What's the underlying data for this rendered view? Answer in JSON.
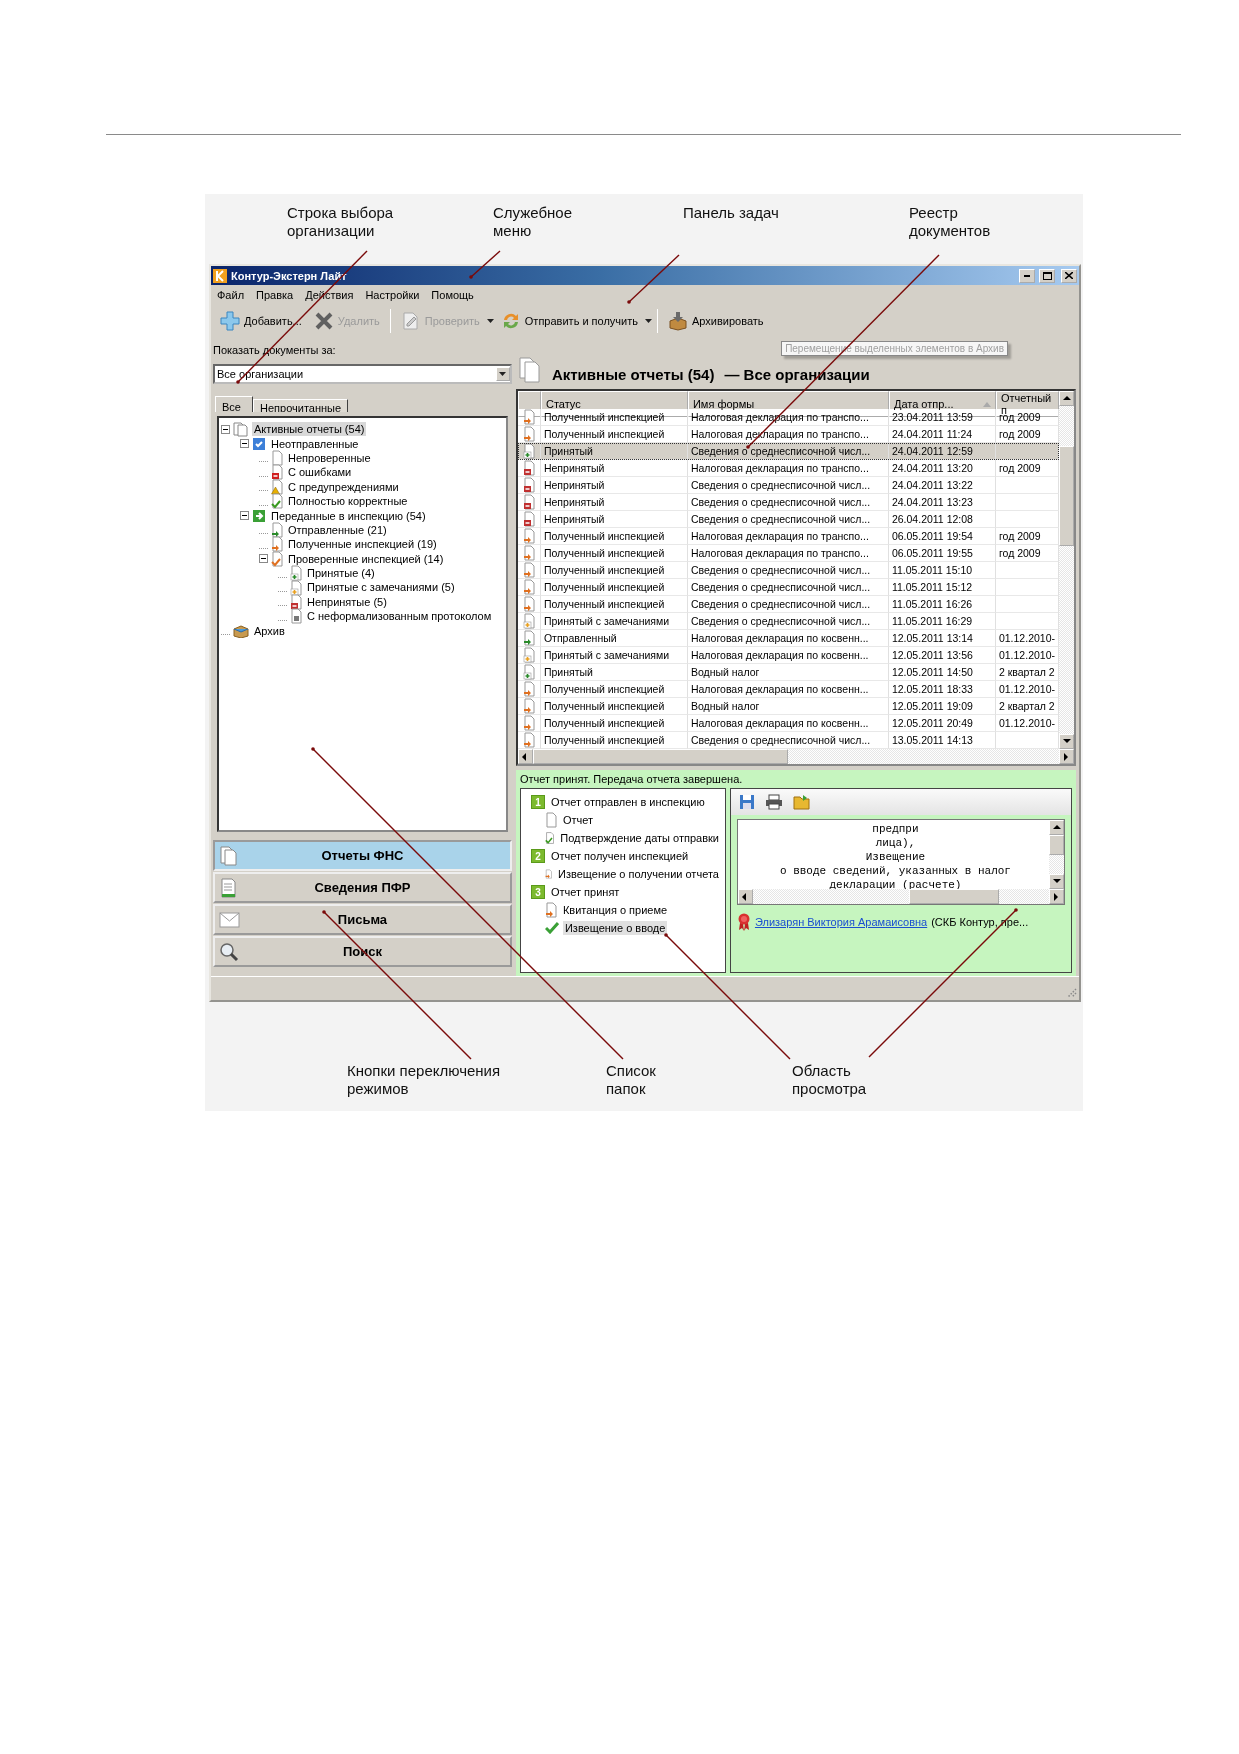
{
  "annotations_top": [
    "Строка выбора организации",
    "Служебное меню",
    "Панель задач",
    "Реестр документов"
  ],
  "window": {
    "title": "Контур-Экстерн Лайт"
  },
  "menu": [
    "Файл",
    "Правка",
    "Действия",
    "Настройки",
    "Помощь"
  ],
  "toolbar": [
    {
      "kind": "add",
      "label": "Добавить...",
      "disabled": false,
      "dropdown": false,
      "separator_after": false
    },
    {
      "kind": "delete",
      "label": "Удалить",
      "disabled": true,
      "dropdown": false,
      "separator_after": true
    },
    {
      "kind": "check",
      "label": "Проверить",
      "disabled": true,
      "dropdown": true,
      "separator_after": false
    },
    {
      "kind": "exchange",
      "label": "Отправить и получить",
      "disabled": false,
      "dropdown": true,
      "separator_after": true
    },
    {
      "kind": "archive",
      "label": "Архивировать",
      "disabled": false,
      "dropdown": false,
      "separator_after": false
    }
  ],
  "tooltip": "Перемещение выделенных элементов в Архив",
  "filter": {
    "label": "Показать документы за:",
    "value": "Все организации"
  },
  "folder_tabs": [
    {
      "label": "Все",
      "selected": true
    },
    {
      "label": "Непрочитанные",
      "selected": false
    }
  ],
  "folders": [
    {
      "label": "Активные отчеты (54)",
      "kind": "stack",
      "selected": true,
      "children": [
        {
          "label": "Неотправленные",
          "kind": "unsent",
          "selected": false,
          "children": [
            {
              "label": "Непроверенные",
              "kind": "blank",
              "selected": false
            },
            {
              "label": "С ошибками",
              "kind": "error",
              "selected": false
            },
            {
              "label": "С предупреждениями",
              "kind": "warning",
              "selected": false
            },
            {
              "label": "Полностью корректные",
              "kind": "correct",
              "selected": false
            }
          ]
        },
        {
          "label": "Переданные в инспекцию (54)",
          "kind": "transferred",
          "selected": false,
          "children": [
            {
              "label": "Отправленные (21)",
              "kind": "sent",
              "selected": false
            },
            {
              "label": "Полученные инспекцией (19)",
              "kind": "received",
              "selected": false
            },
            {
              "label": "Проверенные инспекцией (14)",
              "kind": "checked",
              "selected": false,
              "children": [
                {
                  "label": "Принятые (4)",
                  "kind": "accepted",
                  "selected": false
                },
                {
                  "label": "Принятые с замечаниями (5)",
                  "kind": "remarks",
                  "selected": false
                },
                {
                  "label": "Непринятые (5)",
                  "kind": "rejected",
                  "selected": false
                },
                {
                  "label": "С неформализованным протоколом",
                  "kind": "protocol",
                  "selected": false
                }
              ]
            }
          ]
        }
      ]
    },
    {
      "label": "Архив",
      "kind": "archive",
      "selected": false
    }
  ],
  "nav": [
    {
      "kind": "reports",
      "label": "Отчеты ФНС",
      "selected": true
    },
    {
      "kind": "pfr",
      "label": "Сведения ПФР",
      "selected": false
    },
    {
      "kind": "letters",
      "label": "Письма",
      "selected": false
    },
    {
      "kind": "search",
      "label": "Поиск",
      "selected": false
    }
  ],
  "list_header": {
    "title": "Активные отчеты (54)",
    "subtitle": "— Все организации"
  },
  "table": {
    "columns": [
      {
        "label": "Статус",
        "sorted": false
      },
      {
        "label": "Имя формы",
        "sorted": false
      },
      {
        "label": "Дата отпр...",
        "sorted": true
      },
      {
        "label": "Отчетный п",
        "sorted": false
      }
    ],
    "rows": [
      {
        "kind": "received",
        "status": "Полученный инспекцией",
        "form": "Налоговая декларация по транспо...",
        "date": "23.04.2011 13:59",
        "period": "год 2009",
        "selected": false
      },
      {
        "kind": "received",
        "status": "Полученный инспекцией",
        "form": "Налоговая декларация по транспо...",
        "date": "24.04.2011 11:24",
        "period": "год 2009",
        "selected": false
      },
      {
        "kind": "accepted",
        "status": "Принятый",
        "form": "Сведения о среднесписочной числ...",
        "date": "24.04.2011 12:59",
        "selected": true
      },
      {
        "kind": "rejected",
        "status": "Непринятый",
        "form": "Налоговая декларация по транспо...",
        "date": "24.04.2011 13:20",
        "period": "год 2009",
        "selected": false
      },
      {
        "kind": "rejected",
        "status": "Непринятый",
        "form": "Сведения о среднесписочной числ...",
        "date": "24.04.2011 13:22",
        "selected": false
      },
      {
        "kind": "rejected",
        "status": "Непринятый",
        "form": "Сведения о среднесписочной числ...",
        "date": "24.04.2011 13:23",
        "selected": false
      },
      {
        "kind": "rejected",
        "status": "Непринятый",
        "form": "Сведения о среднесписочной числ...",
        "date": "26.04.2011 12:08",
        "selected": false
      },
      {
        "kind": "received",
        "status": "Полученный инспекцией",
        "form": "Налоговая декларация по транспо...",
        "date": "06.05.2011 19:54",
        "period": "год 2009",
        "selected": false
      },
      {
        "kind": "received",
        "status": "Полученный инспекцией",
        "form": "Налоговая декларация по транспо...",
        "date": "06.05.2011 19:55",
        "period": "год 2009",
        "selected": false
      },
      {
        "kind": "received",
        "status": "Полученный инспекцией",
        "form": "Сведения о среднесписочной числ...",
        "date": "11.05.2011 15:10",
        "selected": false
      },
      {
        "kind": "received",
        "status": "Полученный инспекцией",
        "form": "Сведения о среднесписочной числ...",
        "date": "11.05.2011 15:12",
        "selected": false
      },
      {
        "kind": "received",
        "status": "Полученный инспекцией",
        "form": "Сведения о среднесписочной числ...",
        "date": "11.05.2011 16:26",
        "selected": false
      },
      {
        "kind": "remarks",
        "status": "Принятый с замечаниями",
        "form": "Сведения о среднесписочной числ...",
        "date": "11.05.2011 16:29",
        "selected": false
      },
      {
        "kind": "sent",
        "status": "Отправленный",
        "form": "Налоговая декларация по косвенн...",
        "date": "12.05.2011 13:14",
        "period": "01.12.2010-",
        "selected": false
      },
      {
        "kind": "remarks",
        "status": "Принятый с замечаниями",
        "form": "Налоговая декларация по косвенн...",
        "date": "12.05.2011 13:56",
        "period": "01.12.2010-",
        "selected": false
      },
      {
        "kind": "accepted",
        "status": "Принятый",
        "form": "Водный налог",
        "date": "12.05.2011 14:50",
        "period": "2 квартал 2",
        "selected": false
      },
      {
        "kind": "received",
        "status": "Полученный инспекцией",
        "form": "Налоговая декларация по косвенн...",
        "date": "12.05.2011 18:33",
        "period": "01.12.2010-",
        "selected": false
      },
      {
        "kind": "received",
        "status": "Полученный инспекцией",
        "form": "Водный налог",
        "date": "12.05.2011 19:09",
        "period": "2 квартал 2",
        "selected": false
      },
      {
        "kind": "received",
        "status": "Полученный инспекцией",
        "form": "Налоговая декларация по косвенн...",
        "date": "12.05.2011 20:49",
        "period": "01.12.2010-",
        "selected": false
      },
      {
        "kind": "received",
        "status": "Полученный инспекцией",
        "form": "Сведения о среднесписочной числ...",
        "date": "13.05.2011 14:13",
        "selected": false
      }
    ]
  },
  "status_message": "Отчет принят. Передача отчета завершена.",
  "steps": [
    {
      "number": "1",
      "label": "Отчет отправлен в инспекцию",
      "documents": [
        {
          "kind": "blank",
          "label": "Отчет",
          "selected": false
        },
        {
          "kind": "confirm",
          "label": "Подтверждение даты отправки",
          "selected": false
        }
      ]
    },
    {
      "number": "2",
      "label": "Отчет получен инспекцией",
      "documents": [
        {
          "kind": "received",
          "label": "Извещение о получении отчета",
          "selected": false
        }
      ]
    },
    {
      "number": "3",
      "label": "Отчет принят",
      "documents": [
        {
          "kind": "received",
          "label": "Квитанция о приеме",
          "selected": false
        },
        {
          "kind": "tick",
          "label": "Извещение о вводе",
          "selected": true
        }
      ]
    }
  ],
  "preview": {
    "lines": [
      "предпри",
      "лица),",
      "Извещение",
      "о вводе сведений, указанных в налог",
      "декларации (расчете)"
    ],
    "signer": "Элизарян Виктория Арамаисовна",
    "signer_org": "(СКБ Контур, пре..."
  },
  "annotations_bottom": [
    "Кнопки переключения режимов",
    "Список папок",
    "Область просмотра"
  ]
}
